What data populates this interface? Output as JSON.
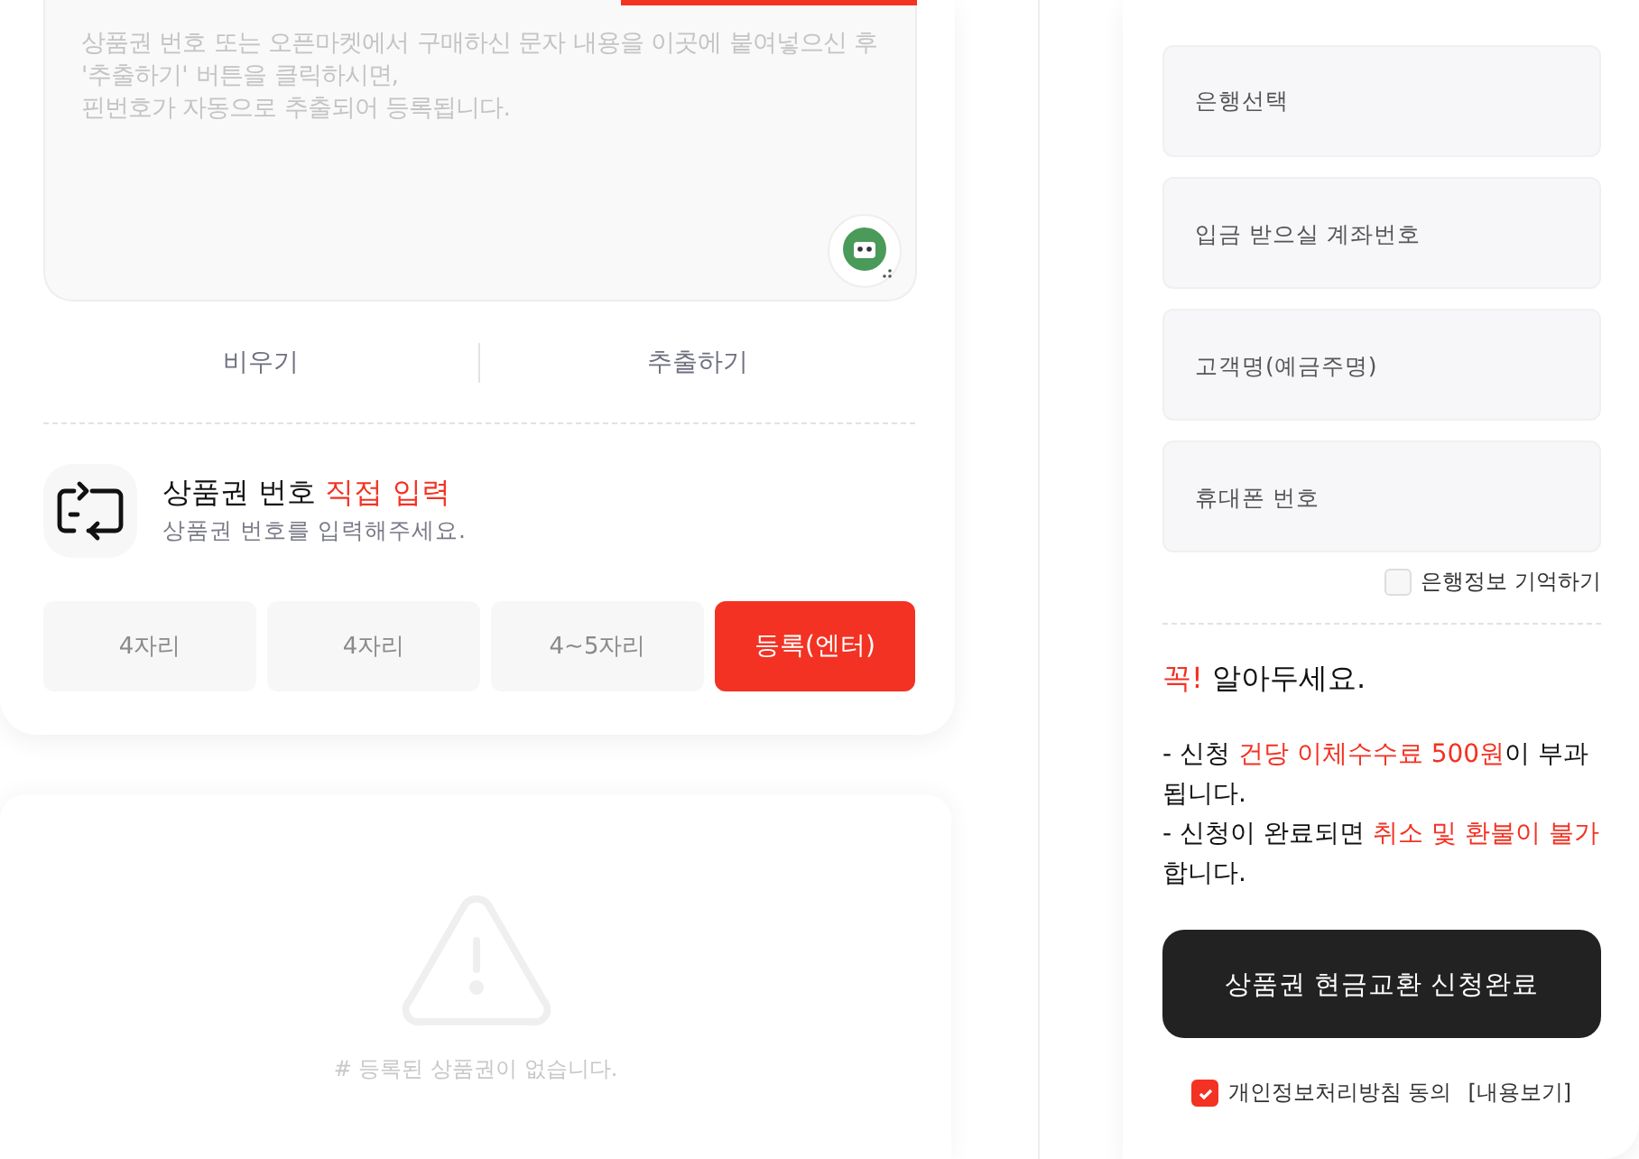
{
  "paste_area": {
    "placeholder": "상품권 번호 또는 오픈마켓에서 구매하신 문자 내용을 이곳에 붙여넣으신 후 '추출하기' 버튼을 클릭하시면,\n핀번호가 자동으로 추출되어 등록됩니다."
  },
  "paste_actions": [
    "비우기",
    "추출하기"
  ],
  "direct_entry": {
    "title": "상품권 번호",
    "title_highlight": "직접 입력",
    "subtitle": "상품권 번호를 입력해주세요.",
    "fields": [
      {
        "placeholder": "4자리"
      },
      {
        "placeholder": "4자리"
      },
      {
        "placeholder": "4~5자리"
      }
    ],
    "submit": "등록(엔터)"
  },
  "empty_list": {
    "message": "# 등록된 상품권이 없습니다."
  },
  "bank_form": {
    "fields": [
      {
        "kind": "select",
        "placeholder": "은행선택"
      },
      {
        "kind": "input",
        "placeholder": "입금 받으실 계좌번호"
      },
      {
        "kind": "input",
        "placeholder": "고객명(예금주명)"
      },
      {
        "kind": "input",
        "placeholder": "휴대폰 번호"
      }
    ],
    "remember": {
      "label": "은행정보 기억하기",
      "checked": false
    }
  },
  "notice": {
    "title_highlight": "꼭!",
    "title": "알아두세요.",
    "lines": [
      [
        {
          "text": "- 신청 ",
          "highlight": false
        },
        {
          "text": "건당 이체수수료 500원",
          "highlight": true
        },
        {
          "text": "이 부과됩니다.",
          "highlight": false
        }
      ],
      [
        {
          "text": "- 신청이 완료되면 ",
          "highlight": false
        },
        {
          "text": "취소 및 환불이 불가",
          "highlight": true
        },
        {
          "text": "합니다.",
          "highlight": false
        }
      ]
    ]
  },
  "submit_button": "상품권 현금교환 신청완료",
  "agree": {
    "label": "개인정보처리방침 동의",
    "link": "[내용보기]",
    "checked": true
  }
}
